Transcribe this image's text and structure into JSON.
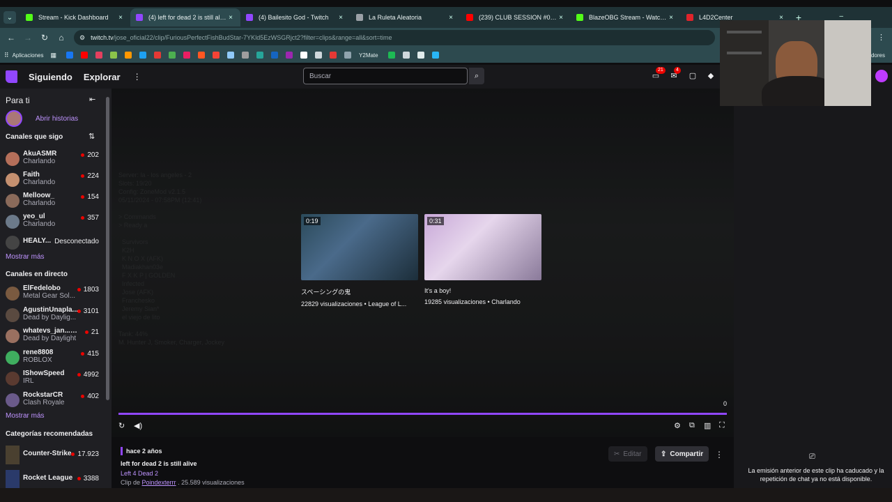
{
  "browser": {
    "tabs": [
      {
        "title": "Stream - Kick Dashboard",
        "color": "#53fc18"
      },
      {
        "title": "(4) left for dead 2 is still alive",
        "color": "#9147ff"
      },
      {
        "title": "(4) Bailesito God - Twitch",
        "color": "#9147ff"
      },
      {
        "title": "La Ruleta Aleatoria",
        "color": "#9aa0a6"
      },
      {
        "title": "(239) CLUB SESSION #01 | (DJ S",
        "color": "#ff0000"
      },
      {
        "title": "BlazeOBG Stream - Watch Live",
        "color": "#53fc18"
      },
      {
        "title": "L4D2Center",
        "color": "#e0242b"
      }
    ],
    "url_host": "twitch.tv",
    "url_path": "/jose_oficial22/clip/FuriousPerfectFishBudStar-7YKld5EzWSGRjct2?filter=clips&range=all&sort=time",
    "bookmarks_apps": "Aplicaciones",
    "bookmark_y2mate": "Y2Mate",
    "bookmark_right": "adores"
  },
  "twitch": {
    "nav_following": "Siguiendo",
    "nav_browse": "Explorar",
    "search_placeholder": "Buscar",
    "notif_badge_1": "21",
    "notif_badge_2": "4"
  },
  "sidebar": {
    "for_you": "Para ti",
    "stories": "Abrir historias",
    "followed_heading": "Canales que sigo",
    "followed": [
      {
        "name": "AkuASMR",
        "game": "Charlando",
        "viewers": "202",
        "live": true
      },
      {
        "name": "Faith",
        "game": "Charlando",
        "viewers": "224",
        "live": true
      },
      {
        "name": "Melloow_",
        "game": "Charlando",
        "viewers": "154",
        "live": true
      },
      {
        "name": "yeo_ul",
        "game": "Charlando",
        "viewers": "357",
        "live": true
      },
      {
        "name": "HEALY...",
        "game": "",
        "viewers": "Desconectado",
        "live": false
      }
    ],
    "show_more_1": "Mostrar más",
    "live_heading": "Canales en directo",
    "live": [
      {
        "name": "ElFedelobo",
        "game": "Metal Gear Sol...",
        "viewers": "1803"
      },
      {
        "name": "AgustinUnapla...",
        "game": "Dead by Daylig...",
        "viewers": "3101"
      },
      {
        "name": "whatevs_jan... +1",
        "game": "Dead by Daylight",
        "viewers": "21"
      },
      {
        "name": "rene8808",
        "game": "ROBLOX",
        "viewers": "415"
      },
      {
        "name": "IShowSpeed",
        "game": "IRL",
        "viewers": "4992"
      },
      {
        "name": "RockstarCR",
        "game": "Clash Royale",
        "viewers": "402"
      }
    ],
    "show_more_2": "Mostrar más",
    "cat_heading": "Categorías recomendadas",
    "categories": [
      {
        "name": "Counter-Strike",
        "viewers": "17.923"
      },
      {
        "name": "Rocket League",
        "viewers": "3388"
      }
    ]
  },
  "player": {
    "overlay_text": "Server: la - los angeles - 2\nSlots: 19/20\nConfig: ZoneMod v2.1.5\n05/11/2024 - 07:58PM (12:41)\n\n> Commands\n> Ready a\n\n  Survivors\n  K2H\n  K N O X (AFK)\n  Madiakhan03e\n  F X K P | GOLDEN\n  Infected\n  Jose (AFK)\n  Franchesko\n  Jeremy Sian*\n  el viejo de lito\n\nTank: 44%\nM. Hunter J, Smoker, Charger, Jockey",
    "recs": [
      {
        "duration": "0:19",
        "title": "スペーシングの鬼",
        "sub": "22829 visualizaciones • League of L..."
      },
      {
        "duration": "0:31",
        "title": "It's a boy!",
        "sub": "19285 visualizaciones • Charlando"
      }
    ],
    "counter": "0"
  },
  "clip": {
    "ago": "hace 2 años",
    "title": "left for dead 2 is still alive",
    "game": "Left 4 Dead 2",
    "clip_by": "Clip de",
    "author": "Poindexterrr",
    "views": ". 25.589 visualizaciones",
    "edit": "Editar",
    "share": "Compartir"
  },
  "chat": {
    "expired_msg": "La emisión anterior de este clip ha caducado y la repetición de chat ya no está disponible."
  }
}
